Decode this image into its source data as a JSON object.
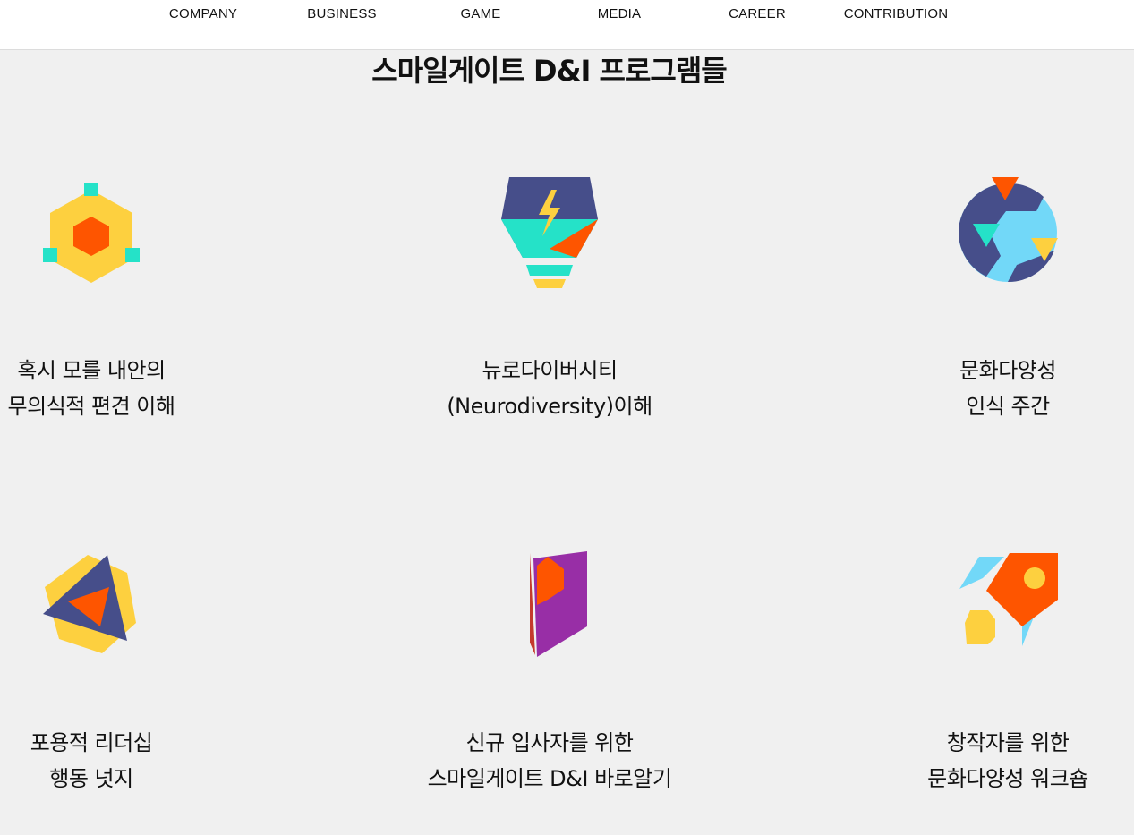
{
  "nav": {
    "items": [
      "COMPANY",
      "BUSINESS",
      "GAME",
      "MEDIA",
      "CAREER",
      "CONTRIBUTION"
    ]
  },
  "section": {
    "title": "스마일게이트 D&I 프로그램들"
  },
  "programs": [
    {
      "line1": "혹시 모를 내안의",
      "line2": "무의식적 편견 이해",
      "icon": "hexagon-nodes-icon"
    },
    {
      "line1": "뉴로다이버시티",
      "line2": "(Neurodiversity)이해",
      "icon": "lightbulb-bolt-icon"
    },
    {
      "line1": "문화다양성",
      "line2": "인식 주간",
      "icon": "globe-icon"
    },
    {
      "line1": "포용적 리더십",
      "line2": "행동 넛지",
      "icon": "triangle-hexagon-icon"
    },
    {
      "line1": "신규 입사자를 위한",
      "line2": "스마일게이트 D&I 바로알기",
      "icon": "book-icon"
    },
    {
      "line1": "창작자를 위한",
      "line2": "문화다양성 워크숍",
      "icon": "rocket-icon"
    }
  ],
  "colors": {
    "background": "#f0f0f0",
    "yellow": "#fdd03f",
    "orange": "#fe5500",
    "teal": "#25e2c8",
    "navy": "#464e8a",
    "skyblue": "#72d8f8",
    "purple": "#982ea6"
  }
}
